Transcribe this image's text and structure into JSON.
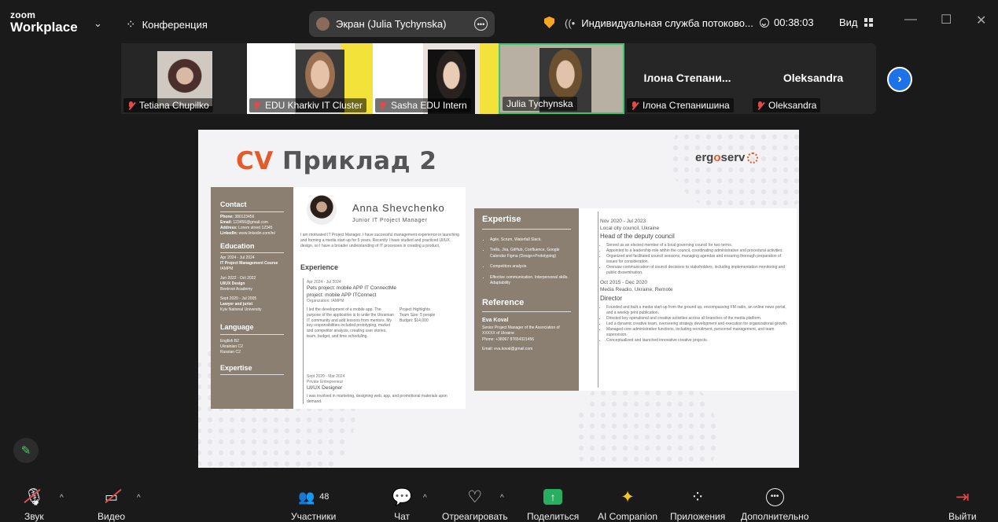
{
  "app": {
    "zoom": "zoom",
    "workplace": "Workplace"
  },
  "header": {
    "conference": "Конференция",
    "screen_share": "Экран (Julia Tychynska)",
    "stream": "Индивидуальная служба потоково...",
    "timer": "00:38:03",
    "view": "Вид"
  },
  "participants": [
    {
      "name": "Tetiana Chupilko",
      "muted": true,
      "video": true
    },
    {
      "name": "EDU Kharkiv IT Cluster",
      "muted": true,
      "video": true
    },
    {
      "name": "Sasha EDU Intern",
      "muted": true,
      "video": true
    },
    {
      "name": "Julia Tychynska",
      "muted": false,
      "video": true,
      "active": true
    },
    {
      "name": "Ілона Степанишина",
      "display": "Ілона Степани...",
      "muted": true,
      "video": false
    },
    {
      "name": "Oleksandra",
      "display": "Oleksandra",
      "muted": true,
      "video": false
    }
  ],
  "slide": {
    "title_cv": "CV",
    "title_rest": "Приклад 2",
    "brand_a": "erg",
    "brand_o": "o",
    "brand_b": "serv",
    "cv1": {
      "contact": "Contact",
      "phone": "Phone:",
      "email": "Email:",
      "address": "Address:",
      "linkedin": "LinkedIn:",
      "education": "Education",
      "edu1_date": "Apr 2024 - Jul 2024",
      "edu1": "IT Project Management Course",
      "edu1_org": "IAMPM",
      "edu2_date": "Jun 2022 - Oct 2022",
      "edu2": "UI/UX Design",
      "edu2_org": "Beetroot Academy",
      "edu3_date": "Sept 2020 - Jul 2005",
      "edu3": "Lawyer and jurist",
      "edu3_org": "Kyiv National University",
      "language": "Language",
      "lang1": "English B2",
      "lang2": "Ukrainian C2",
      "lang3": "Russian C2",
      "expertise": "Expertise",
      "name": "Anna Shevchenko",
      "role": "Junior IT Project Manager",
      "experience": "Experience",
      "exp1_date": "Apr 2024 - Jul 2024",
      "exp1_t1": "Pets project: mobile APP IT ConnectMe",
      "exp1_t2": "project: mobile APP ITConnect",
      "exp1_org": "Organization: IAMPM",
      "exp1_hl": "Project Highlights",
      "exp2_date": "Sept 2020 - Mar 2024",
      "exp2_org": "Private Entrepreneur",
      "exp2_t": "UI/UX Designer"
    },
    "cv2": {
      "expertise": "Expertise",
      "skills": [
        "Agile, Scrum, Waterfall Slack.",
        "Trello, Jira, GitHub, Confluence, Google Calendar Figma (Design+Prototyping)",
        "Competitors analysis",
        "Effective communication. Interpersonal skills. Adaptability"
      ],
      "reference": "Reference",
      "ref_name": "Eva Koval",
      "ref_role": "Senior Project Manager of the Association of XXXXX of Ukraine",
      "ref_phone": "Phone: +38067 87654321456",
      "ref_email_l": "Email:",
      "ref_email": "eva.koval@gmail.com",
      "job1_date": "Nov 2020 - Jul 2023",
      "job1_org": "Local city council, Ukraine",
      "job1_title": "Head of the deputy council",
      "job1_items": [
        "Served as an elected member of a local governing council for two terms.",
        "Appointed to a leadership role within the council, coordinating administrative and procedural activities.",
        "Organized and facilitated council sessions, managing agendas and ensuring thorough preparation of issues for consideration.",
        "Oversaw communication of council decisions to stakeholders, including implementation monitoring and public dissemination."
      ],
      "job2_date": "Oct 2015 - Dec 2020",
      "job2_org": "Media Readio, Ukraine, Remote",
      "job2_title": "Director",
      "job2_items": [
        "Founded and built a media start-up from the ground up, encompassing FM radio, an online news portal, and a weekly print publication.",
        "Directed key operational and creative activities across all branches of the media platform.",
        "Led a dynamic creative team, overseeing strategy development and execution for organizational growth.",
        "Managed core administrative functions, including recruitment, personnel management, and team supervision.",
        "Conceptualized and launched innovative creative projects."
      ]
    }
  },
  "toolbar": {
    "audio": "Звук",
    "video": "Видео",
    "participants": "Участники",
    "participants_count": "48",
    "chat": "Чат",
    "react": "Отреагировать",
    "share": "Поделиться",
    "ai": "AI Companion",
    "apps": "Приложения",
    "more": "Дополнительно",
    "leave": "Выйти"
  },
  "colors": {
    "accent": "#e35a2b",
    "share": "#27ae60",
    "active_tile": "#3ec46d",
    "next": "#1e72e8"
  }
}
